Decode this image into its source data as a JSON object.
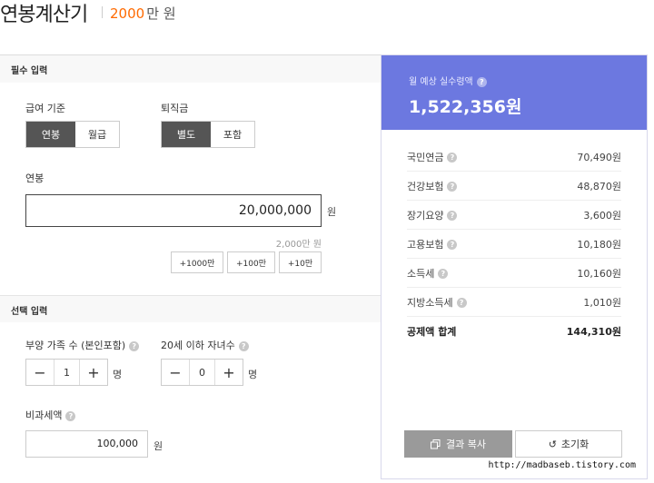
{
  "header": {
    "title": "연봉계산기",
    "amount": "2000",
    "unit": "만 원"
  },
  "left": {
    "required_title": "필수 입력",
    "pay_basis": {
      "label": "급여 기준",
      "options": [
        "연봉",
        "월급"
      ]
    },
    "severance": {
      "label": "퇴직금",
      "options": [
        "별도",
        "포함"
      ]
    },
    "salary": {
      "label": "연봉",
      "value": "20,000,000",
      "unit": "원",
      "hint": "2,000만 원"
    },
    "quick_buttons": [
      "+1000만",
      "+100만",
      "+10만"
    ],
    "optional_title": "선택 입력",
    "dependents": {
      "label": "부양 가족 수 (본인포함)",
      "value": "1",
      "unit": "명"
    },
    "children": {
      "label": "20세 이하 자녀수",
      "value": "0",
      "unit": "명"
    },
    "nontax": {
      "label": "비과세액",
      "value": "100,000",
      "unit": "원"
    }
  },
  "result": {
    "label": "월 예상 실수령액",
    "amount": "1,522,356원",
    "deductions": [
      {
        "name": "국민연금",
        "value": "70,490원"
      },
      {
        "name": "건강보험",
        "value": "48,870원"
      },
      {
        "name": "장기요양",
        "value": "3,600원"
      },
      {
        "name": "고용보험",
        "value": "10,180원"
      },
      {
        "name": "소득세",
        "value": "10,160원"
      },
      {
        "name": "지방소득세",
        "value": "1,010원"
      }
    ],
    "total": {
      "name": "공제액 합계",
      "value": "144,310원"
    },
    "copy_label": "결과 복사",
    "reset_label": "초기화"
  },
  "watermark": "http://madbaseb.tistory.com",
  "colors": {
    "accent": "#ff6a00",
    "result_bg": "#6c78e0",
    "active_btn": "#555555"
  }
}
